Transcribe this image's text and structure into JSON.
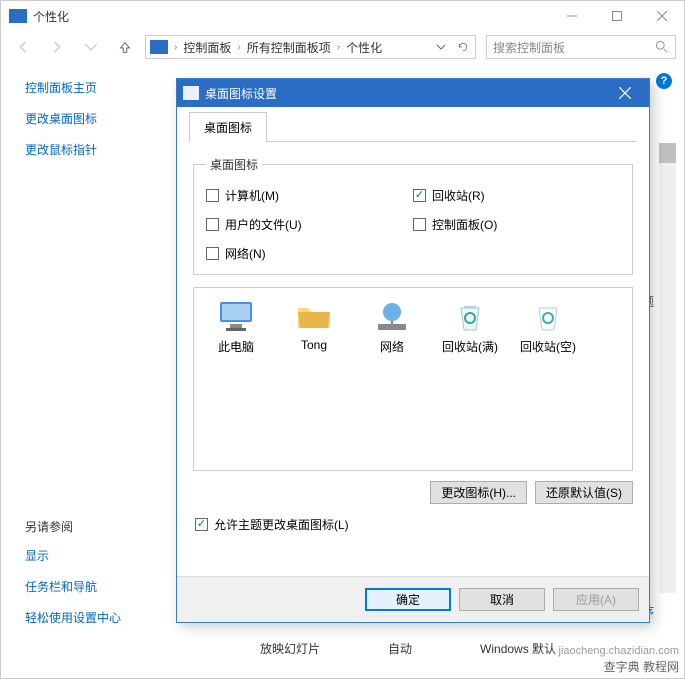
{
  "window": {
    "title": "个性化",
    "breadcrumb": [
      "控制面板",
      "所有控制面板项",
      "个性化"
    ],
    "search_placeholder": "搜索控制面板"
  },
  "sidebar": {
    "home": "控制面板主页",
    "change_icons": "更改桌面图标",
    "change_cursor": "更改鼠标指针",
    "see_also": "另请参阅",
    "display": "显示",
    "taskbar": "任务栏和导航",
    "ease": "轻松使用设置中心"
  },
  "main": {
    "back_text": "题",
    "back_link": "P程序",
    "cats": [
      "放映幻灯片",
      "自动",
      "Windows 默认"
    ]
  },
  "dialog": {
    "title": "桌面图标设置",
    "tab": "桌面图标",
    "legend": "桌面图标",
    "checks": {
      "computer": {
        "label": "计算机(M)",
        "checked": false
      },
      "recycle": {
        "label": "回收站(R)",
        "checked": true
      },
      "userfiles": {
        "label": "用户的文件(U)",
        "checked": false
      },
      "controlpanel": {
        "label": "控制面板(O)",
        "checked": false
      },
      "network": {
        "label": "网络(N)",
        "checked": false
      }
    },
    "icons": [
      "此电脑",
      "Tong",
      "网络",
      "回收站(满)",
      "回收站(空)"
    ],
    "change_icon_btn": "更改图标(H)...",
    "restore_btn": "还原默认值(S)",
    "allow_themes": {
      "label": "允许主题更改桌面图标(L)",
      "checked": true
    },
    "ok": "确定",
    "cancel": "取消",
    "apply": "应用(A)"
  },
  "watermark": {
    "main": "查字典 教程网",
    "sub": "jiaocheng.chazidian.com"
  }
}
